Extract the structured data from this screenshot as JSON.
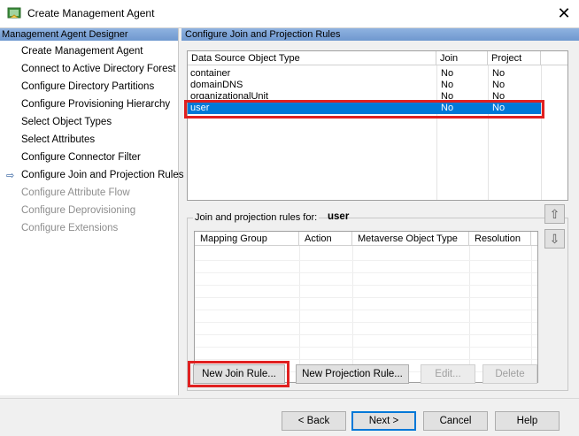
{
  "window": {
    "title": "Create Management Agent",
    "close_glyph": "✕"
  },
  "nav": {
    "header": "Management Agent Designer",
    "current_marker": "⇨",
    "items": [
      {
        "label": "Create Management Agent",
        "enabled": true
      },
      {
        "label": "Connect to Active Directory Forest",
        "enabled": true
      },
      {
        "label": "Configure Directory Partitions",
        "enabled": true
      },
      {
        "label": "Configure Provisioning Hierarchy",
        "enabled": true
      },
      {
        "label": "Select Object Types",
        "enabled": true
      },
      {
        "label": "Select Attributes",
        "enabled": true
      },
      {
        "label": "Configure Connector Filter",
        "enabled": true
      },
      {
        "label": "Configure Join and Projection Rules",
        "enabled": true,
        "current": true
      },
      {
        "label": "Configure Attribute Flow",
        "enabled": false
      },
      {
        "label": "Configure Deprovisioning",
        "enabled": false
      },
      {
        "label": "Configure Extensions",
        "enabled": false
      }
    ]
  },
  "panel": {
    "header": "Configure Join and Projection Rules",
    "object_grid": {
      "columns": [
        "Data Source Object Type",
        "Join",
        "Project"
      ],
      "rows": [
        {
          "type": "container",
          "join": "No",
          "project": "No"
        },
        {
          "type": "domainDNS",
          "join": "No",
          "project": "No"
        },
        {
          "type": "organizationalUnit",
          "join": "No",
          "project": "No"
        },
        {
          "type": "user",
          "join": "No",
          "project": "No",
          "selected": true
        }
      ]
    },
    "rules": {
      "label": "Join and projection rules for:",
      "object_type": "user",
      "columns": [
        "Mapping Group",
        "Action",
        "Metaverse Object Type",
        "Resolution"
      ],
      "up_icon": "⇧",
      "down_icon": "⇩"
    },
    "buttons": {
      "new_join_rule": "New Join Rule...",
      "new_projection_rule": "New Projection Rule...",
      "edit": "Edit...",
      "delete": "Delete"
    }
  },
  "footer": {
    "back": "< Back",
    "next": "Next >",
    "cancel": "Cancel",
    "help": "Help"
  },
  "colors": {
    "highlight": "#e02020",
    "selection": "#0078d7",
    "header_blue": "#7aa1d6"
  }
}
